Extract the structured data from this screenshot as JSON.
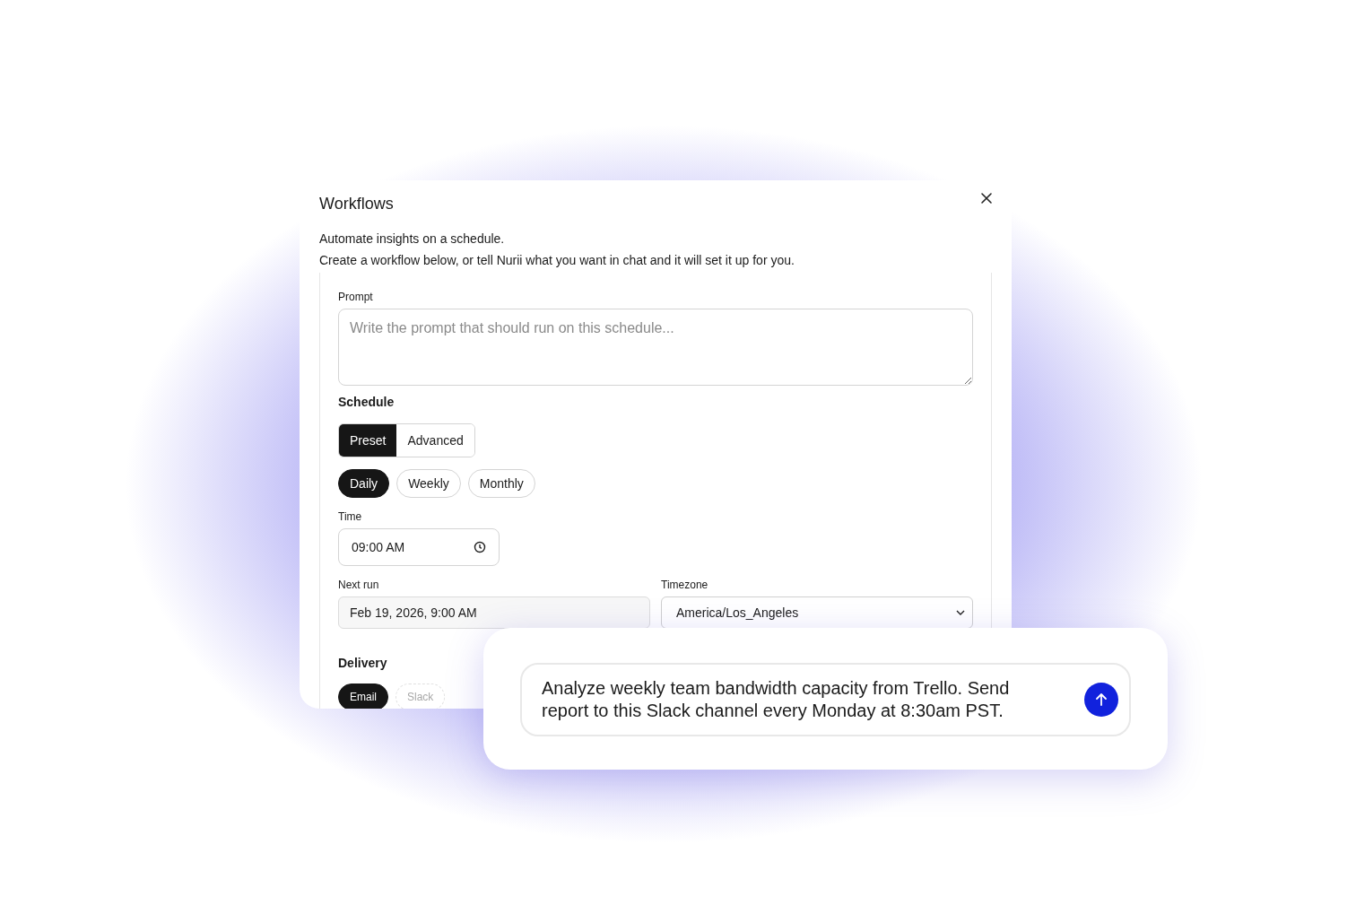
{
  "dialog": {
    "title": "Workflows",
    "subtitle": "Automate insights on a schedule.",
    "description": "Create a workflow below, or tell Nurii what you want in chat and it will set it up for you.",
    "prompt": {
      "label": "Prompt",
      "placeholder": "Write the prompt that should run on this schedule..."
    },
    "schedule": {
      "heading": "Schedule",
      "modes": [
        {
          "label": "Preset",
          "selected": true
        },
        {
          "label": "Advanced",
          "selected": false
        }
      ],
      "frequencies": [
        {
          "label": "Daily",
          "selected": true
        },
        {
          "label": "Weekly",
          "selected": false
        },
        {
          "label": "Monthly",
          "selected": false
        }
      ],
      "time": {
        "label": "Time",
        "value": "09:00 AM"
      },
      "next_run": {
        "label": "Next run",
        "value": "Feb 19, 2026, 9:00 AM"
      },
      "timezone": {
        "label": "Timezone",
        "value": "America/Los_Angeles"
      }
    },
    "delivery": {
      "heading": "Delivery",
      "options": [
        {
          "label": "Email",
          "selected": true,
          "disabled": false
        },
        {
          "label": "Slack",
          "selected": false,
          "disabled": true
        }
      ]
    }
  },
  "chat": {
    "message": "Analyze weekly team bandwidth capacity from Trello. Send report to this Slack channel every Monday at 8:30am PST."
  }
}
